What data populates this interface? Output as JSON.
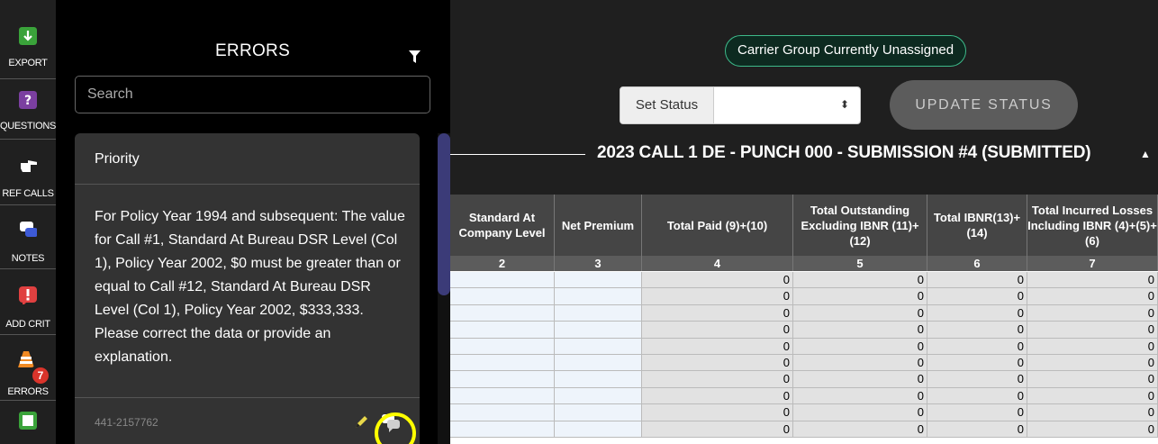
{
  "sidebar": {
    "items": [
      {
        "label": "EXPORT",
        "icon": "export-icon",
        "color": "#3aa33a"
      },
      {
        "label": "QUESTIONS",
        "icon": "question-icon",
        "color": "#7b3fa0"
      },
      {
        "label": "REF CALLS",
        "icon": "pointing-hand-icon",
        "color": "#ffffff"
      },
      {
        "label": "NOTES",
        "icon": "chat-bubbles-icon",
        "color": "#ffffff"
      },
      {
        "label": "ADD CRIT",
        "icon": "exclamation-icon",
        "color": "#e04040"
      },
      {
        "label": "ERRORS",
        "icon": "traffic-cone-icon",
        "color": "#f08a24",
        "badge": "7"
      },
      {
        "label": "",
        "icon": "square-icon",
        "color": "#3aa33a"
      }
    ]
  },
  "errors_panel": {
    "title": "ERRORS",
    "search_placeholder": "Search",
    "card": {
      "priority": "Priority",
      "message": "For Policy Year 1994 and subsequent: The value for Call #1, Standard At Bureau DSR Level (Col 1), Policy Year 2002, $0 must be greater than or equal to Call #12, Standard At Bureau DSR Level (Col 1), Policy Year 2002, $333,333. Please correct the data or provide an explanation.",
      "id": "441-2157762"
    }
  },
  "main": {
    "carrier_badge": "Carrier Group Currently Unassigned",
    "set_status_label": "Set Status",
    "set_status_value": "",
    "update_button": "UPDATE STATUS",
    "submission_title": "2023 CALL 1 DE - PUNCH 000 - SUBMISSION #4 (SUBMITTED)"
  },
  "table": {
    "columns": [
      {
        "header": "Standard At Company Level",
        "number": "2"
      },
      {
        "header": "Net Premium",
        "number": "3"
      },
      {
        "header": "Total Paid (9)+(10)",
        "number": "4"
      },
      {
        "header": "Total Outstanding Excluding IBNR (11)+(12)",
        "number": "5"
      },
      {
        "header": "Total IBNR(13)+(14)",
        "number": "6"
      },
      {
        "header": "Total Incurred Losses Including IBNR (4)+(5)+(6)",
        "number": "7"
      }
    ],
    "rows": [
      [
        "",
        "",
        "0",
        "0",
        "0",
        "0"
      ],
      [
        "",
        "",
        "0",
        "0",
        "0",
        "0"
      ],
      [
        "",
        "",
        "0",
        "0",
        "0",
        "0"
      ],
      [
        "",
        "",
        "0",
        "0",
        "0",
        "0"
      ],
      [
        "",
        "",
        "0",
        "0",
        "0",
        "0"
      ],
      [
        "",
        "",
        "0",
        "0",
        "0",
        "0"
      ],
      [
        "",
        "",
        "0",
        "0",
        "0",
        "0"
      ],
      [
        "",
        "",
        "0",
        "0",
        "0",
        "0"
      ],
      [
        "",
        "",
        "0",
        "0",
        "0",
        "0"
      ],
      [
        "",
        "",
        "0",
        "0",
        "0",
        "0"
      ]
    ]
  }
}
